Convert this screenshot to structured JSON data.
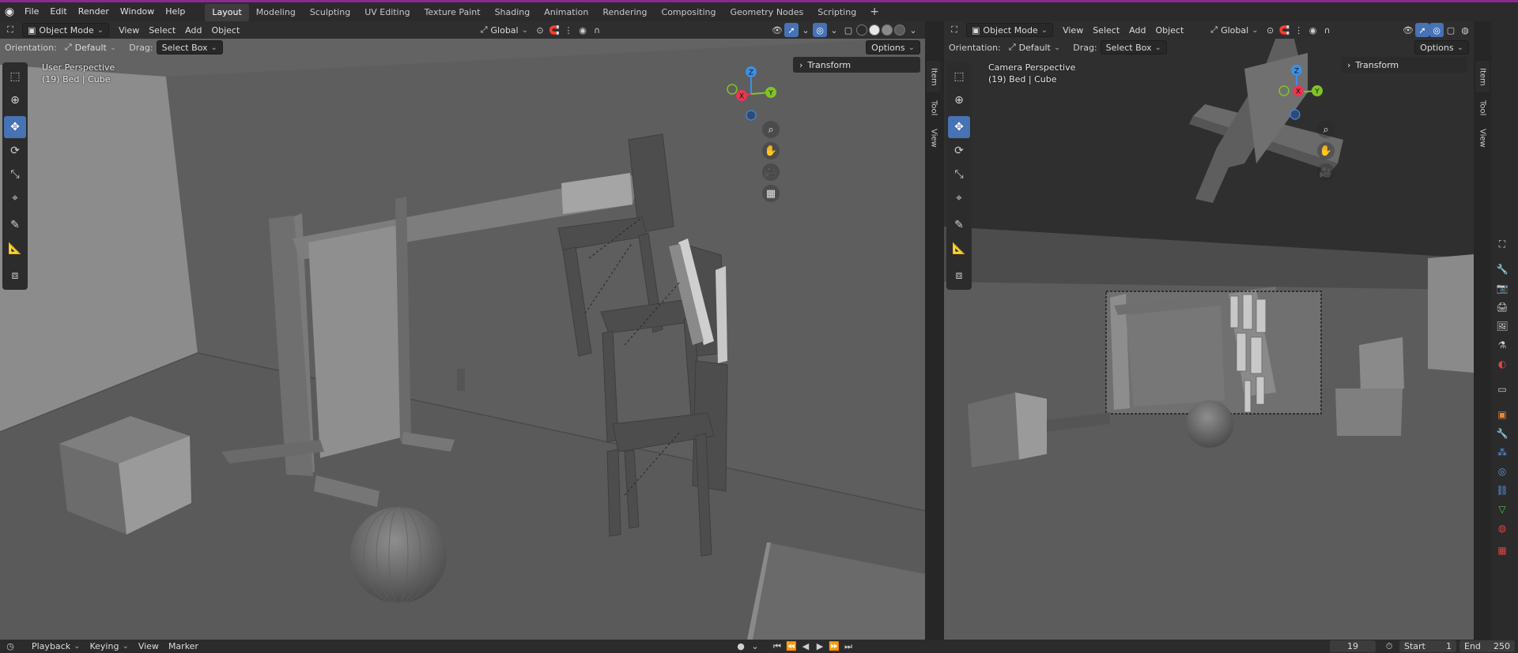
{
  "menubar": {
    "logo": "blender-logo",
    "menus": [
      "File",
      "Edit",
      "Render",
      "Window",
      "Help"
    ],
    "workspaces": [
      "Layout",
      "Modeling",
      "Sculpting",
      "UV Editing",
      "Texture Paint",
      "Shading",
      "Animation",
      "Rendering",
      "Compositing",
      "Geometry Nodes",
      "Scripting"
    ],
    "active_workspace": "Layout",
    "add_label": "+"
  },
  "viewport_left": {
    "mode": "Object Mode",
    "menus": [
      "View",
      "Select",
      "Add",
      "Object"
    ],
    "transform_orientation": "Global",
    "orientation_label": "Orientation:",
    "orientation_value": "Default",
    "drag_label": "Drag:",
    "drag_value": "Select Box",
    "options_label": "Options",
    "overlay_line1": "User Perspective",
    "overlay_line2": "(19) Bed | Cube",
    "transform_panel": "Transform",
    "n_tabs": [
      "Item",
      "Tool",
      "View"
    ],
    "gizmo": {
      "x": "X",
      "y": "Y",
      "z": "Z"
    }
  },
  "viewport_right": {
    "mode": "Object Mode",
    "menus": [
      "View",
      "Select",
      "Add",
      "Object"
    ],
    "transform_orientation": "Global",
    "orientation_label": "Orientation:",
    "orientation_value": "Default",
    "drag_label": "Drag:",
    "drag_value": "Select Box",
    "options_label": "Options",
    "overlay_line1": "Camera Perspective",
    "overlay_line2": "(19) Bed | Cube",
    "transform_panel": "Transform",
    "n_tabs": [
      "Item",
      "Tool",
      "View"
    ],
    "gizmo": {
      "x": "X",
      "y": "Y",
      "z": "Z"
    }
  },
  "timeline": {
    "menus": [
      "Playback",
      "Keying",
      "View",
      "Marker"
    ],
    "current_frame": "19",
    "start_label": "Start",
    "start_value": "1",
    "end_label": "End",
    "end_value": "250"
  },
  "colors": {
    "accent": "#4772b3",
    "axis_x": "#e8374f",
    "axis_y": "#80c327",
    "axis_z": "#3d8fe3",
    "top_strip": "#8a2a8e"
  }
}
